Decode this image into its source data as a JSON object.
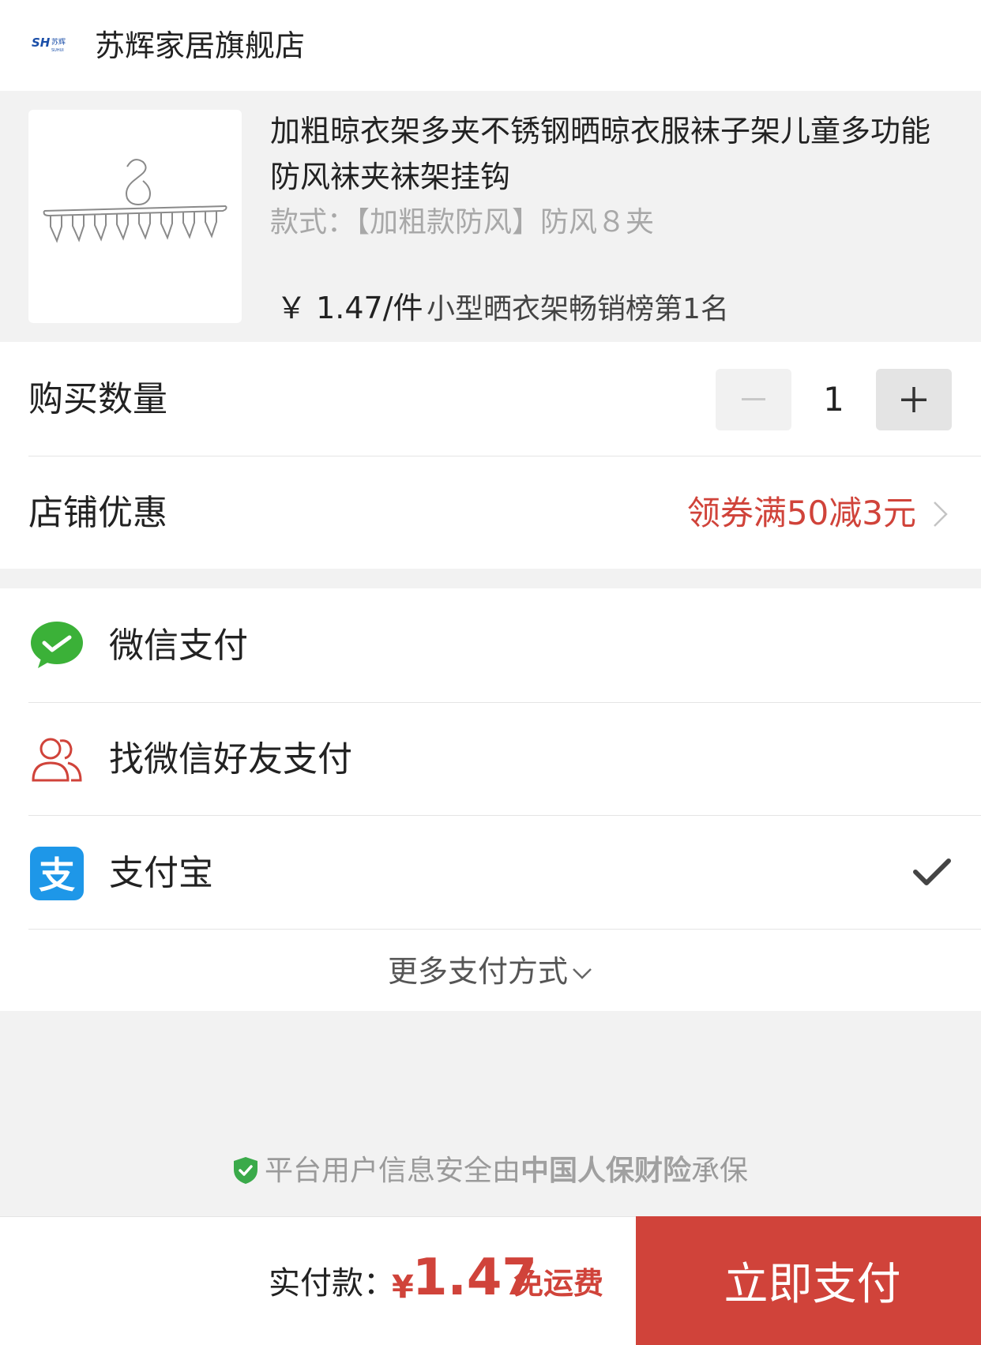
{
  "shop": {
    "name": "苏辉家居旗舰店",
    "logo_icon": "shop-logo-icon"
  },
  "product": {
    "title": "加粗晾衣架多夹不锈钢晒晾衣服袜子架儿童多功能防风袜夹袜架挂钩",
    "spec": "款式：【加粗款防风】防风８夹",
    "price": "￥ 1.47/件",
    "rank": "小型晒衣架畅销榜第1名",
    "image_icon": "clothes-hanger-icon"
  },
  "quantity": {
    "label": "购买数量",
    "value": "1",
    "minus": "−",
    "plus": "+"
  },
  "coupon": {
    "label": "店铺优惠",
    "value": "领券满50减3元",
    "color": "#d0433a"
  },
  "payment": {
    "methods": [
      {
        "label": "微信支付",
        "icon": "wechat-pay-icon",
        "selected": false
      },
      {
        "label": "找微信好友支付",
        "icon": "friends-pay-icon",
        "selected": false
      },
      {
        "label": "支付宝",
        "icon": "alipay-icon",
        "selected": true
      }
    ],
    "more_label": "更多支付方式"
  },
  "security": {
    "prefix": "平台用户信息安全由",
    "brand": "中国人保财险",
    "suffix": "承保"
  },
  "footer": {
    "total_label": "实付款：",
    "currency": "¥",
    "amount": "1.47",
    "shipping": "免运费",
    "pay_button": "立即支付",
    "accent": "#d0433a"
  }
}
